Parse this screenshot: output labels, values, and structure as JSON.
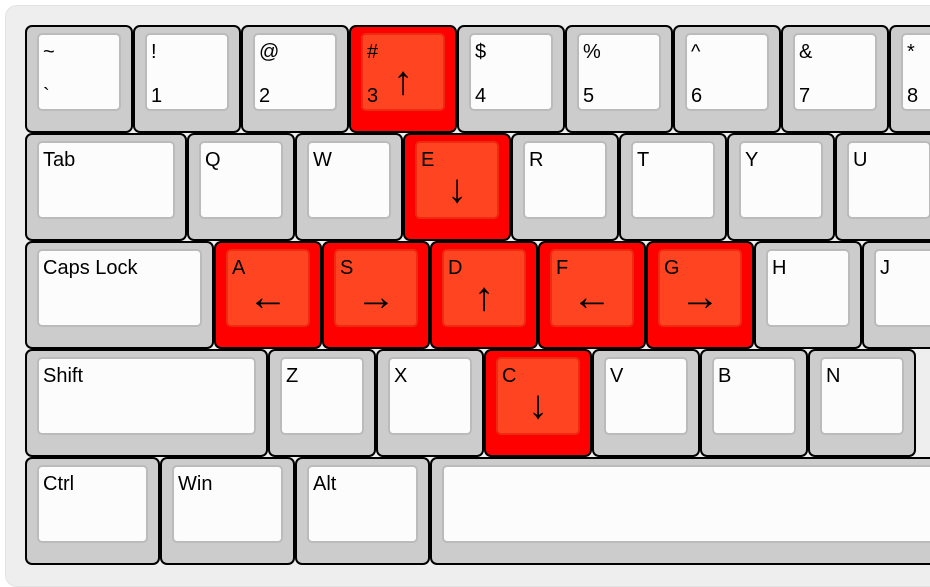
{
  "keyboard": {
    "highlight_color": "#ff0000",
    "highlight_inner_color": "#ff4422",
    "rows": [
      [
        {
          "top": "~",
          "bottom": "`"
        },
        {
          "top": "!",
          "bottom": "1"
        },
        {
          "top": "@",
          "bottom": "2"
        },
        {
          "top": "#",
          "bottom": "3",
          "arrow": "↑",
          "arrow_icon": "arrow-up-icon",
          "highlighted": true
        },
        {
          "top": "$",
          "bottom": "4"
        },
        {
          "top": "%",
          "bottom": "5"
        },
        {
          "top": "^",
          "bottom": "6"
        },
        {
          "top": "&",
          "bottom": "7"
        },
        {
          "top": "*",
          "bottom": "8"
        }
      ],
      [
        {
          "top": "Tab"
        },
        {
          "top": "Q"
        },
        {
          "top": "W"
        },
        {
          "top": "E",
          "arrow": "↓",
          "arrow_icon": "arrow-down-icon",
          "highlighted": true
        },
        {
          "top": "R"
        },
        {
          "top": "T"
        },
        {
          "top": "Y"
        },
        {
          "top": "U"
        }
      ],
      [
        {
          "top": "Caps Lock"
        },
        {
          "top": "A",
          "arrow": "←",
          "arrow_icon": "arrow-left-icon",
          "highlighted": true
        },
        {
          "top": "S",
          "arrow": "→",
          "arrow_icon": "arrow-right-icon",
          "highlighted": true
        },
        {
          "top": "D",
          "arrow": "↑",
          "arrow_icon": "arrow-up-icon",
          "highlighted": true
        },
        {
          "top": "F",
          "arrow": "←",
          "arrow_icon": "arrow-left-icon",
          "highlighted": true
        },
        {
          "top": "G",
          "arrow": "→",
          "arrow_icon": "arrow-right-icon",
          "highlighted": true
        },
        {
          "top": "H"
        },
        {
          "top": "J"
        }
      ],
      [
        {
          "top": "Shift"
        },
        {
          "top": "Z"
        },
        {
          "top": "X"
        },
        {
          "top": "C",
          "arrow": "↓",
          "arrow_icon": "arrow-down-icon",
          "highlighted": true
        },
        {
          "top": "V"
        },
        {
          "top": "B"
        },
        {
          "top": "N"
        }
      ],
      [
        {
          "top": "Ctrl"
        },
        {
          "top": "Win"
        },
        {
          "top": "Alt"
        },
        {
          "top": ""
        }
      ]
    ]
  }
}
